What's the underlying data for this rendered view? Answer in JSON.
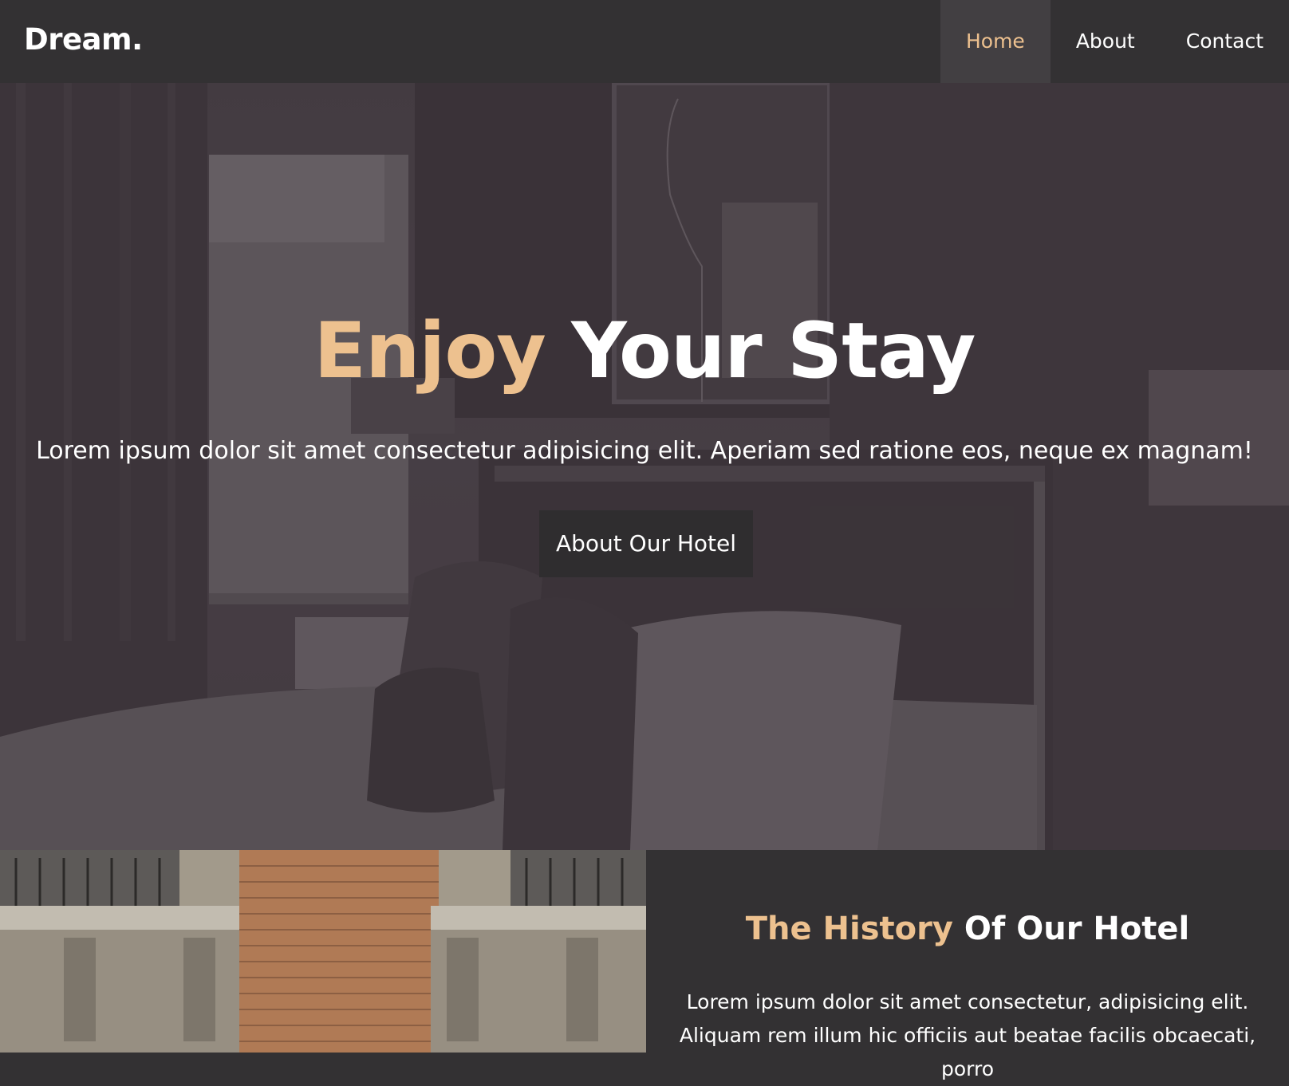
{
  "navbar": {
    "brand": "Dream.",
    "links": [
      {
        "label": "Home",
        "active": true
      },
      {
        "label": "About",
        "active": false
      },
      {
        "label": "Contact",
        "active": false
      }
    ]
  },
  "hero": {
    "title_accent": "Enjoy",
    "title_rest": " Your Stay",
    "subtitle": "Lorem ipsum dolor sit amet consectetur adipisicing elit. Aperiam sed ratione eos, neque ex magnam!",
    "button_label": "About Our Hotel"
  },
  "history": {
    "title_accent": "The History",
    "title_rest": " Of Our Hotel",
    "text": "Lorem ipsum dolor sit amet consectetur, adipisicing elit. Aliquam rem illum hic officiis aut beatae facilis obcaecati, porro"
  },
  "colors": {
    "accent": "#edc18f",
    "background": "#333133",
    "button_bg": "#2f2d2f"
  }
}
